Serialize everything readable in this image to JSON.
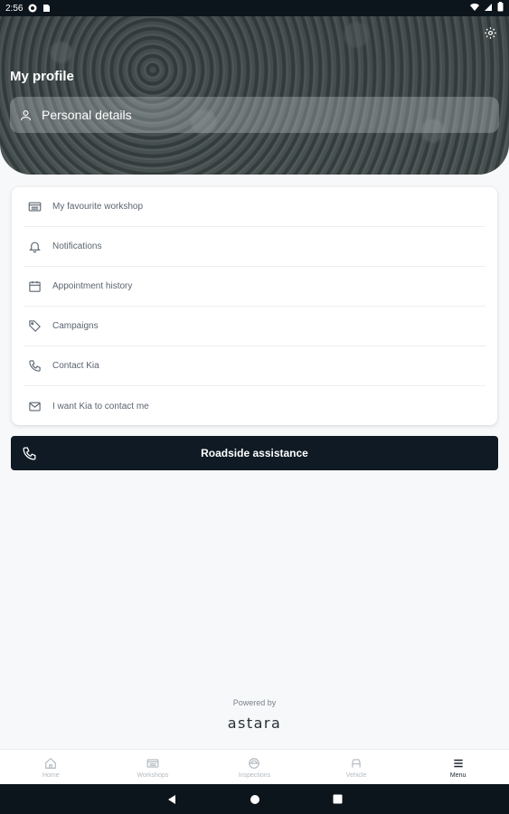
{
  "status_bar": {
    "time": "2:56"
  },
  "header": {
    "title": "My profile",
    "personal_details_label": "Personal details"
  },
  "menu": {
    "items": [
      {
        "label": "My favourite workshop",
        "icon": "workshop-icon"
      },
      {
        "label": "Notifications",
        "icon": "bell-icon"
      },
      {
        "label": "Appointment history",
        "icon": "calendar-icon"
      },
      {
        "label": "Campaigns",
        "icon": "tag-icon"
      },
      {
        "label": "Contact Kia",
        "icon": "phone-icon"
      },
      {
        "label": "I want Kia to contact me",
        "icon": "mail-icon"
      }
    ]
  },
  "roadside": {
    "label": "Roadside assistance"
  },
  "footer": {
    "powered_by": "Powered by",
    "brand": "astara"
  },
  "bottom_nav": {
    "items": [
      {
        "label": "Home",
        "icon": "home-icon"
      },
      {
        "label": "Workshops",
        "icon": "workshop-icon"
      },
      {
        "label": "Inspections",
        "icon": "inspection-icon"
      },
      {
        "label": "Vehicle",
        "icon": "car-icon"
      },
      {
        "label": "Menu",
        "icon": "menu-icon"
      }
    ],
    "active": "Menu"
  },
  "colors": {
    "dark": "#0f1a24",
    "background": "#f7f8fa",
    "muted": "#b3b9bf"
  }
}
